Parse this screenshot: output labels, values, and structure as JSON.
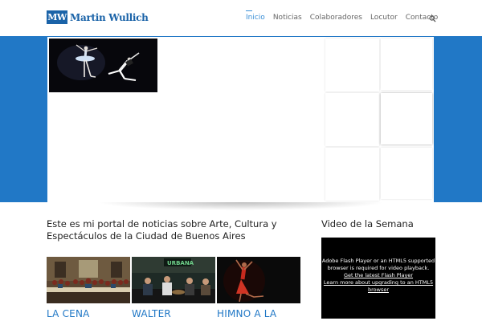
{
  "header": {
    "logo_mark": "MW",
    "logo_text": "Martin Wullich",
    "nav": [
      {
        "label": "Inicio",
        "active": true
      },
      {
        "label": "Noticias",
        "active": false
      },
      {
        "label": "Colaboradores",
        "active": false
      },
      {
        "label": "Locutor",
        "active": false
      },
      {
        "label": "Contacto",
        "active": false
      }
    ],
    "search_icon": "search-icon"
  },
  "colors": {
    "brand_blue": "#1a63a8",
    "band_blue": "#2178c6",
    "nav_active": "#3a8fd6"
  },
  "intro": {
    "text": "Este es mi portal de noticias sobre Arte, Cultura y Espectáculos de la Ciudad de Buenos Aires"
  },
  "video": {
    "title": "Video de la Semana",
    "message_line1": "Adobe Flash Player or an HTML5 supported",
    "message_line2": "browser is required for video playback.",
    "link1": "Get the latest Flash Player",
    "link2_line1": "Learn more about upgrading to an HTML5",
    "link2_line2": "browser"
  },
  "news": [
    {
      "title": "LA CENA"
    },
    {
      "title": "WALTER"
    },
    {
      "title": "HIMNO A LA"
    }
  ]
}
